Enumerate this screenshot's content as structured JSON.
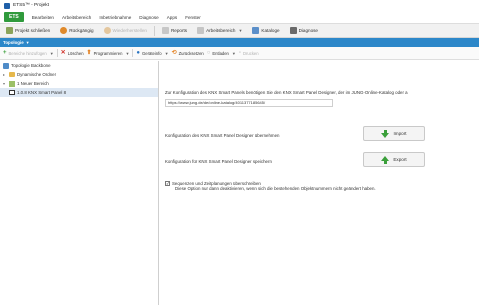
{
  "window": {
    "title": "ETS5™ - Projekt"
  },
  "menu": {
    "ets_tab": "ETS",
    "items": [
      "Bearbeiten",
      "Arbeitsbereich",
      "Inbetriebnahme",
      "Diagnose",
      "Apps",
      "Fenster"
    ]
  },
  "toolbar": {
    "close_project": "Projekt schließen",
    "undo": "Rückgängig",
    "redo": "Wiederherstellen",
    "reports": "Reports",
    "workspace": "Arbeitsbereich",
    "catalogs": "Kataloge",
    "diagnostics": "Diagnose"
  },
  "panel": {
    "title": "Topologie"
  },
  "actions": {
    "add_lines": "Bereiche hinzufügen",
    "delete": "Löschen",
    "program": "Programmieren",
    "info": "Geräteinfo",
    "reset": "Zurücksetzen",
    "unload": "Entladen",
    "print": "Drucken"
  },
  "tree": {
    "items": [
      {
        "label": "Topologie Backbone",
        "icon": "house-icon"
      },
      {
        "label": "Dynamische Ordner",
        "icon": "folder-icon"
      },
      {
        "label": "1 Neuer Bereich",
        "icon": "area-icon"
      },
      {
        "label": "1.0.8 KNX Smart Panel 8",
        "icon": "device-icon"
      }
    ]
  },
  "content": {
    "info_text": "Zur Konfiguration des KNX Smart Panels benötigen Sie den KNX Smart Panel Designer, der im JUNG-Online-Katalog oder a",
    "url": "https://www.jung.de/de/online-katalog/4011377185645/",
    "import_label": "Konfiguration des KNX Smart Panel Designer übernehmen",
    "import_button": "Import",
    "export_label": "Konfiguration für KNX Smart Panel Designer speichern",
    "export_button": "Export",
    "checkbox_line1": "Sequenzen und Zeitplanungen überschreiben",
    "checkbox_line2": "Diese Option nur dann deaktivieren, wenn sich die bestehenden Objektnummern nicht geändert haben.",
    "checkbox_checked": true
  },
  "colors": {
    "accent_blue": "#2c87c9",
    "ets_green": "#2f9a3c",
    "arrow_green": "#3a9f3a"
  }
}
